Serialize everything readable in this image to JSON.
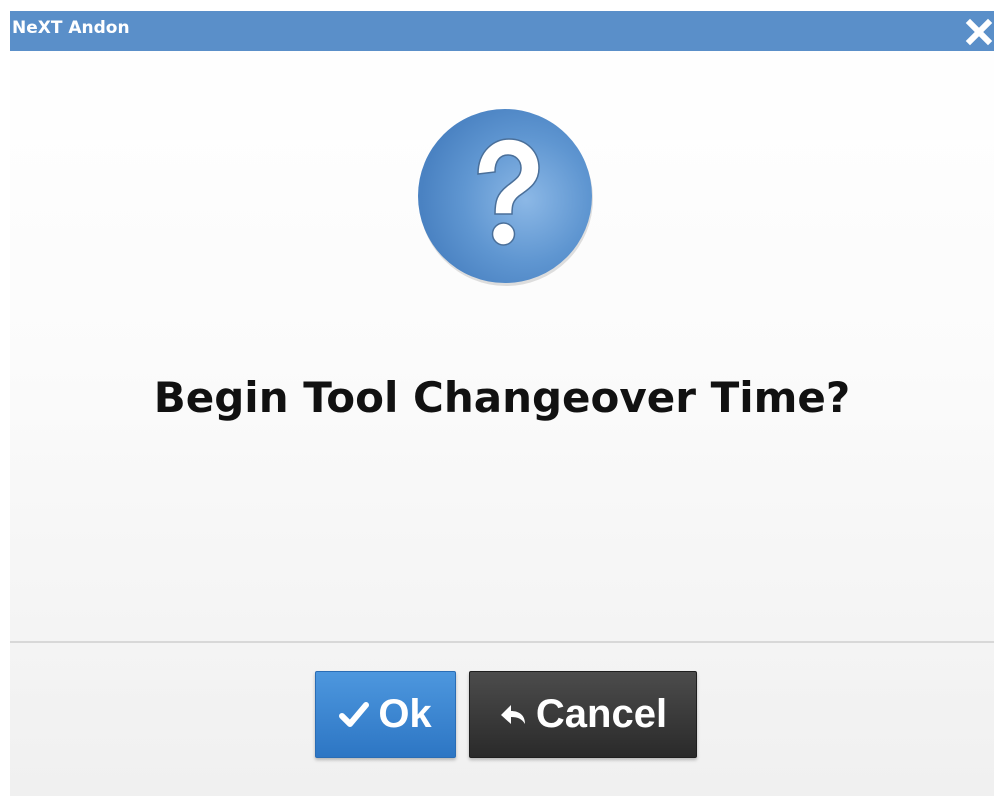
{
  "dialog": {
    "title": "NeXT Andon",
    "message": "Begin Tool Changeover Time?",
    "icon": "question-icon"
  },
  "buttons": {
    "ok_label": "Ok",
    "ok_icon": "checkmark-icon",
    "cancel_label": "Cancel",
    "cancel_icon": "reply-arrow-icon"
  },
  "colors": {
    "titlebar": "#5a8fc9",
    "ok_button": "#3a86d2",
    "cancel_button": "#333333",
    "question_icon": "#5b93d0"
  }
}
